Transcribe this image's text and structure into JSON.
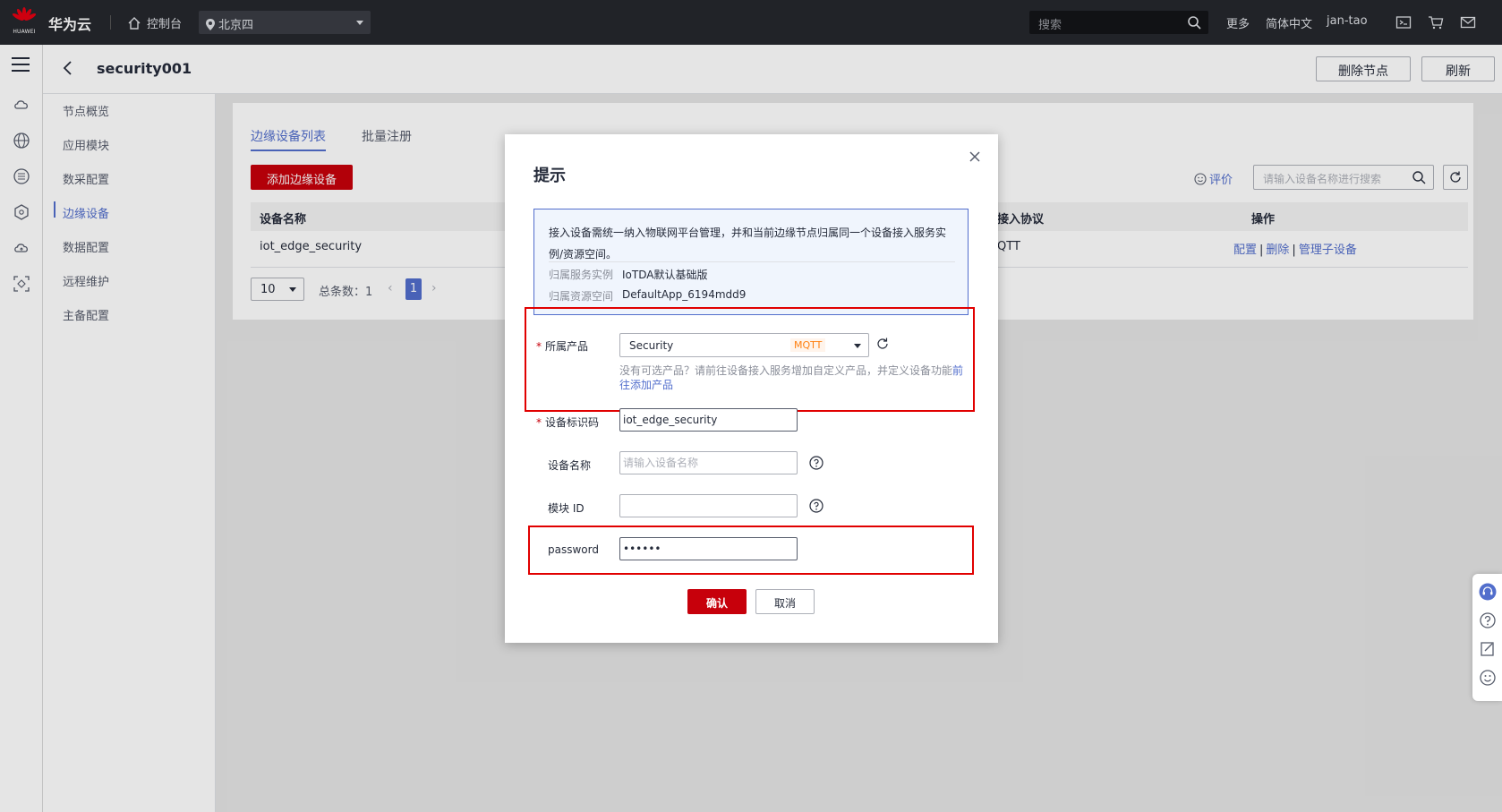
{
  "topbar": {
    "logo_text": "HUAWEI",
    "brand": "华为云",
    "console": "控制台",
    "region": "北京四",
    "search_placeholder": "搜索",
    "more": "更多",
    "language": "简体中文",
    "user": "jan-tao"
  },
  "page": {
    "title": "security001",
    "delete_node": "删除节点",
    "refresh": "刷新"
  },
  "nav": {
    "items": [
      "节点概览",
      "应用模块",
      "数采配置",
      "边缘设备",
      "数据配置",
      "远程维护",
      "主备配置"
    ],
    "active": "边缘设备"
  },
  "panel": {
    "tabs": [
      "边缘设备列表",
      "批量注册"
    ],
    "add_button": "添加边缘设备",
    "rate": "评价",
    "search_placeholder": "请输入设备名称进行搜索",
    "columns": [
      "设备名称",
      "接入协议",
      "操作"
    ],
    "column_fragment": "i",
    "rows": [
      {
        "name": "iot_edge_security",
        "col2_fragment": "i",
        "protocol_fragment": "QTT",
        "ops": [
          "配置",
          "删除",
          "管理子设备"
        ]
      }
    ],
    "page_size": "10",
    "total": "总条数：1",
    "current_page": "1"
  },
  "dialog": {
    "title": "提示",
    "notice": "接入设备需统一纳入物联网平台管理，并和当前边缘节点归属同一个设备接入服务实例/资源空间。",
    "instance_label": "归属服务实例",
    "instance_value": "IoTDA默认基础版",
    "space_label": "归属资源空间",
    "space_value": "DefaultApp_6194mdd9",
    "product_label": "所属产品",
    "product_value": "Security",
    "product_tag": "MQTT",
    "hint_text": "没有可选产品？请前往设备接入服务增加自定义产品，并定义设备功能",
    "hint_link": "前往添加产品",
    "device_id_label": "设备标识码",
    "device_id_value": "iot_edge_security",
    "device_name_label": "设备名称",
    "device_name_placeholder": "请输入设备名称",
    "module_id_label": "模块 ID",
    "module_id_value": "",
    "password_label": "password",
    "password_value": "••••••",
    "confirm": "确认",
    "cancel": "取消"
  },
  "colors": {
    "topbar_bg": "#25272d",
    "brand_red": "#c7000b",
    "accent_blue": "#526ecc",
    "highlight_box": "#e10000",
    "tag_orange": "#ff8011"
  },
  "icons": [
    "huawei-logo-icon",
    "home-icon",
    "location-pin-icon",
    "search-icon",
    "terminal-icon",
    "cart-icon",
    "mail-icon",
    "menu-icon",
    "back-icon",
    "refresh-icon",
    "smile-icon",
    "close-icon",
    "help-icon",
    "headset-icon",
    "edit-icon"
  ]
}
